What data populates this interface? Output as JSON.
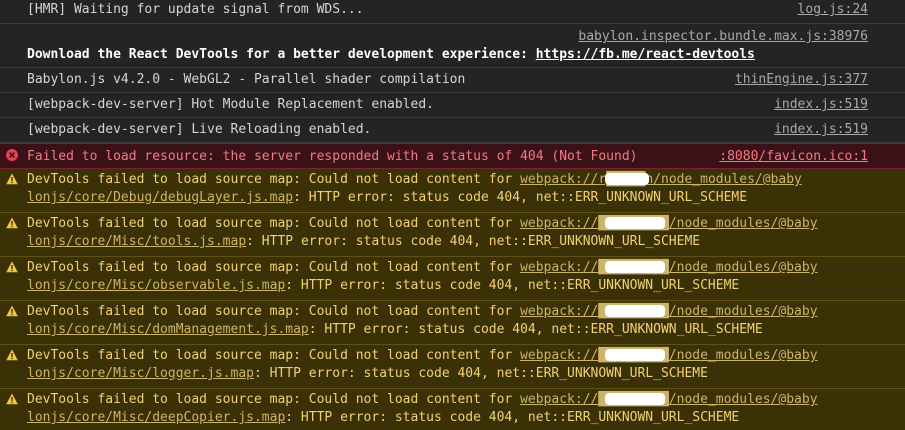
{
  "console": {
    "info_rows": [
      {
        "message": "[HMR] Waiting for update signal from WDS...",
        "source": "log.js:24"
      },
      {
        "message_bold": "Download the React DevTools for a better development experience: ",
        "link": "https://fb.me/react-devtools",
        "source": "babylon.inspector.bundle.max.js:38976"
      },
      {
        "message": "Babylon.js v4.2.0 - WebGL2 - Parallel shader compilation",
        "source": "thinEngine.js:377"
      },
      {
        "message": "[webpack-dev-server] Hot Module Replacement enabled.",
        "source": "index.js:519"
      },
      {
        "message": "[webpack-dev-server] Live Reloading enabled.",
        "source": "index.js:519"
      }
    ],
    "error_row": {
      "icon": "error-circle-icon",
      "message": "Failed to load resource: the server responded with a status of 404 (Not Found)",
      "source": ":8080/favicon.ico:1"
    },
    "warnings": [
      {
        "prefix": "DevTools failed to load source map: Could not load content for ",
        "link1_pre": "webpack://",
        "link1_masked": "r█████n",
        "link1_post": "/node_modules/@baby",
        "link2": "lonjs/core/Debug/debugLayer.js.map",
        "suffix": ": HTTP error: status code 404, net::ERR_UNKNOWN_URL_SCHEME"
      },
      {
        "prefix": "DevTools failed to load source map: Could not load content for ",
        "link1_pre": "webpack://",
        "link1_masked": "█████████",
        "link1_post": "/node_modules/@baby",
        "link2": "lonjs/core/Misc/tools.js.map",
        "suffix": ": HTTP error: status code 404, net::ERR_UNKNOWN_URL_SCHEME"
      },
      {
        "prefix": "DevTools failed to load source map: Could not load content for ",
        "link1_pre": "webpack://",
        "link1_masked": "█████████",
        "link1_post": "/node_modules/@baby",
        "link2": "lonjs/core/Misc/observable.js.map",
        "suffix": ": HTTP error: status code 404, net::ERR_UNKNOWN_URL_SCHEME"
      },
      {
        "prefix": "DevTools failed to load source map: Could not load content for ",
        "link1_pre": "webpack://",
        "link1_masked": "█████████",
        "link1_post": "/node_modules/@baby",
        "link2": "lonjs/core/Misc/domManagement.js.map",
        "suffix": ": HTTP error: status code 404, net::ERR_UNKNOWN_URL_SCHEME"
      },
      {
        "prefix": "DevTools failed to load source map: Could not load content for ",
        "link1_pre": "webpack://",
        "link1_masked": "█████████",
        "link1_post": "/node_modules/@baby",
        "link2": "lonjs/core/Misc/logger.js.map",
        "suffix": ": HTTP error: status code 404, net::ERR_UNKNOWN_URL_SCHEME"
      },
      {
        "prefix": "DevTools failed to load source map: Could not load content for ",
        "link1_pre": "webpack://",
        "link1_masked": "█████████",
        "link1_post": "/node_modules/@baby",
        "link2": "lonjs/core/Misc/deepCopier.js.map",
        "suffix": ": HTTP error: status code 404, net::ERR_UNKNOWN_URL_SCHEME"
      }
    ],
    "warning_icon": "warning-triangle-icon"
  }
}
